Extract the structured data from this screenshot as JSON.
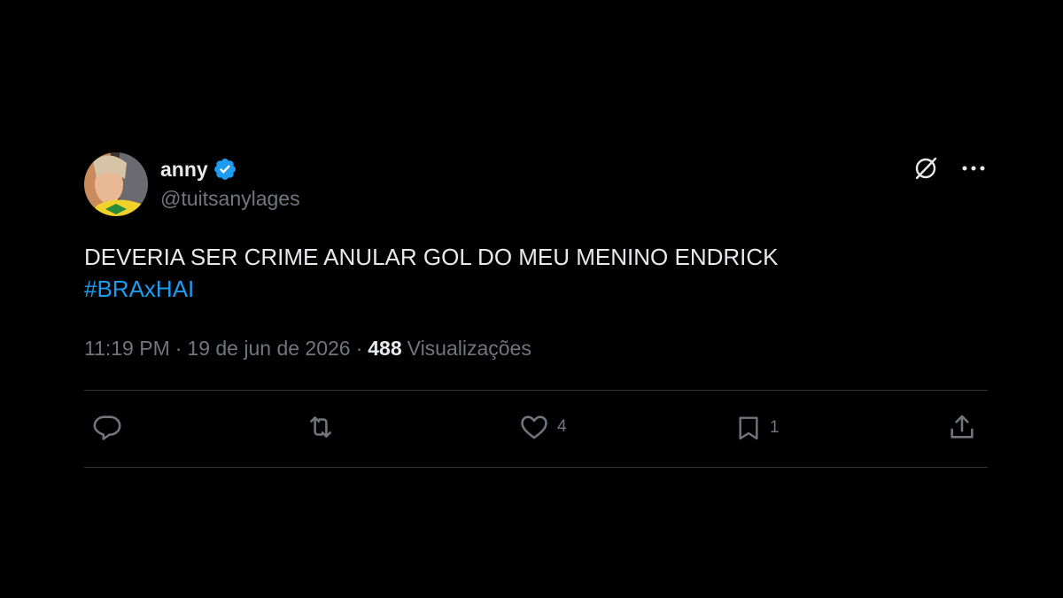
{
  "author": {
    "display_name": "anny",
    "handle": "@tuitsanylages",
    "verified_icon": "verified-badge-icon"
  },
  "tweet": {
    "text": "DEVERIA SER CRIME ANULAR GOL DO MEU MENINO ENDRICK",
    "hashtag": "#BRAxHAI"
  },
  "meta": {
    "time": "11:19 PM",
    "separator": "·",
    "date": "19 de jun de 2026",
    "views_count": "488",
    "views_label": "Visualizações"
  },
  "actions": {
    "reply_count": "",
    "retweet_count": "",
    "like_count": "4",
    "bookmark_count": "1"
  },
  "colors": {
    "background": "#000000",
    "text": "#e7e9ea",
    "secondary": "#71767b",
    "accent": "#1d9bf0",
    "divider": "#2f3336"
  }
}
